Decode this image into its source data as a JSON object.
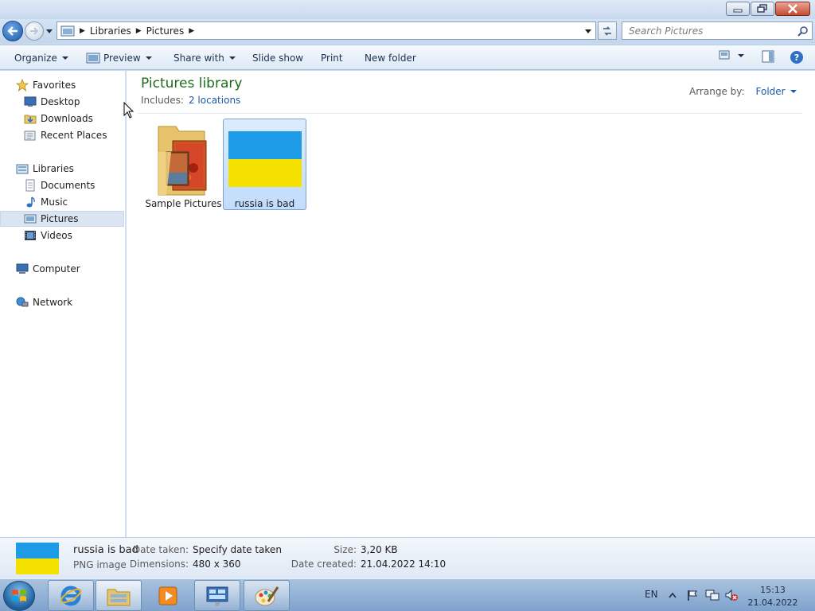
{
  "window": {
    "controls": [
      "minimize",
      "restore",
      "close"
    ]
  },
  "address": {
    "crumbs": [
      "Libraries",
      "Pictures"
    ],
    "search_placeholder": "Search Pictures"
  },
  "toolbar": {
    "organize": "Organize",
    "preview": "Preview",
    "share_with": "Share with",
    "slide_show": "Slide show",
    "print": "Print",
    "new_folder": "New folder"
  },
  "nav": {
    "favorites": "Favorites",
    "desktop": "Desktop",
    "downloads": "Downloads",
    "recent_places": "Recent Places",
    "libraries": "Libraries",
    "documents": "Documents",
    "music": "Music",
    "pictures": "Pictures",
    "videos": "Videos",
    "computer": "Computer",
    "network": "Network",
    "selected": "Pictures"
  },
  "library": {
    "title": "Pictures library",
    "includes_label": "Includes:",
    "includes_link": "2 locations",
    "arrange_label": "Arrange by:",
    "arrange_value": "Folder"
  },
  "files": [
    {
      "name": "Sample Pictures",
      "kind": "folder-icon",
      "selected": false
    },
    {
      "name": "russia is bad",
      "kind": "png-thumbnail",
      "selected": true
    }
  ],
  "details": {
    "name": "russia is bad",
    "type": "PNG image",
    "date_taken_label": "Date taken:",
    "date_taken_value": "Specify date taken",
    "dimensions_label": "Dimensions:",
    "dimensions_value": "480 x 360",
    "size_label": "Size:",
    "size_value": "3,20 KB",
    "date_created_label": "Date created:",
    "date_created_value": "21.04.2022 14:10"
  },
  "taskbar": {
    "apps": [
      "internet-explorer-icon",
      "windows-explorer-icon",
      "media-player-icon",
      "control-panel-icon",
      "paint-icon"
    ],
    "language": "EN",
    "time": "15:13",
    "date": "21.04.2022"
  },
  "colors": {
    "flag_blue": "#1e9be6",
    "flag_yellow": "#f5e100",
    "library_title": "#1e6b1c",
    "link": "#1c5aa8",
    "selection": "#c1dcfc"
  }
}
